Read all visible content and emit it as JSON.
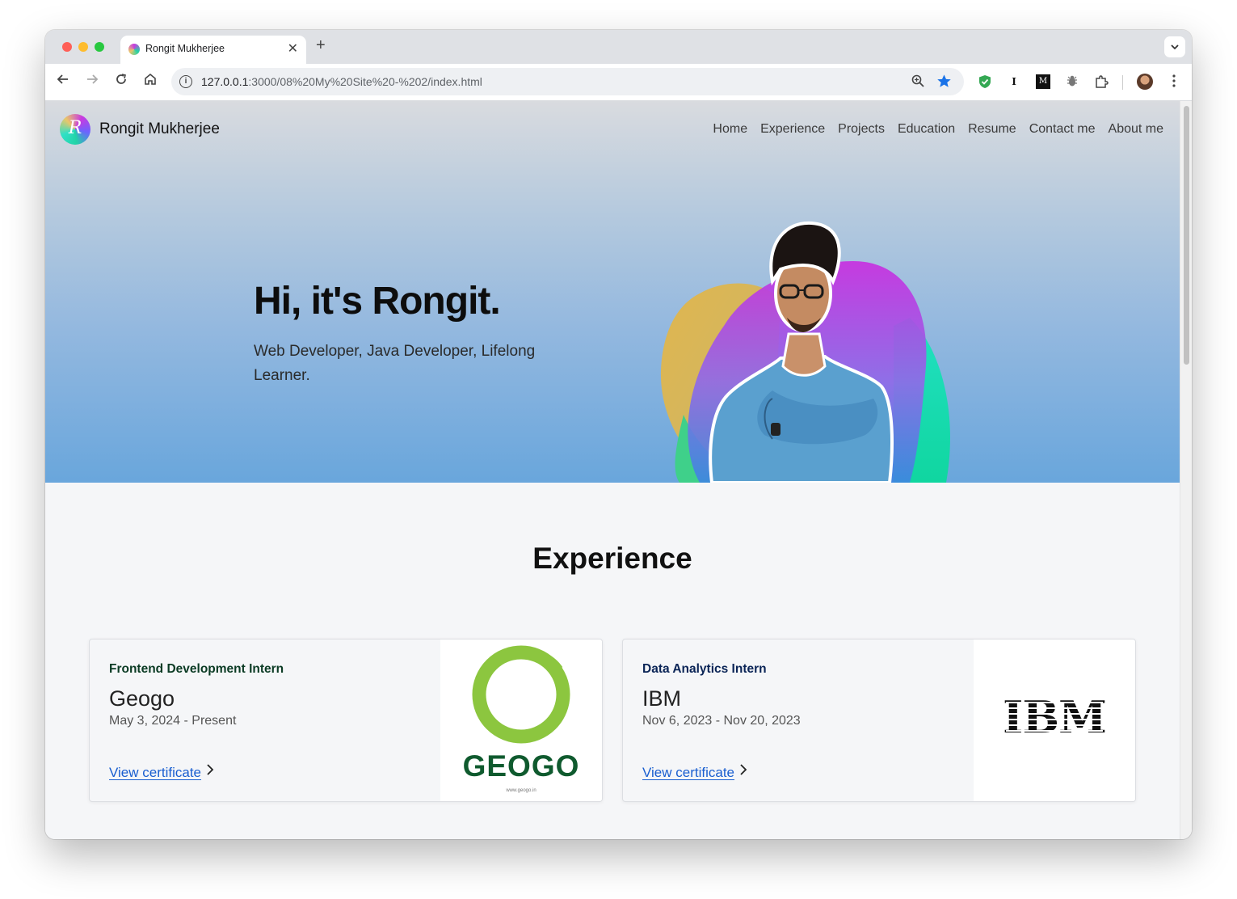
{
  "browser": {
    "tab_title": "Rongit Mukherjee",
    "tab_close": "✕",
    "new_tab": "+",
    "url_host": "127.0.0.1",
    "url_rest": ":3000/08%20My%20Site%20-%202/index.html",
    "icons": [
      "back-arrow-icon",
      "forward-arrow-icon",
      "reload-icon",
      "home-icon",
      "info-icon",
      "zoom-icon",
      "bookmark-star-icon",
      "shield-extension-icon",
      "instapaper-extension-icon",
      "medium-extension-icon",
      "bug-extension-icon",
      "puzzle-extensions-icon",
      "profile-avatar-icon",
      "kebab-menu-icon"
    ]
  },
  "site": {
    "brand_name": "Rongit Mukherjee",
    "brand_initial": "R",
    "nav": [
      "Home",
      "Experience",
      "Projects",
      "Education",
      "Resume",
      "Contact me",
      "About me"
    ]
  },
  "hero": {
    "title": "Hi, it's Rongit.",
    "subtitle": "Web Developer, Java Developer, Lifelong Learner."
  },
  "experience": {
    "heading": "Experience",
    "cards": [
      {
        "role": "Frontend Development Intern",
        "company": "Geogo",
        "dates": "May 3, 2024 - Present",
        "link": "View certificate",
        "logo_text": "GEOGO",
        "logo_caption": "www.geogo.in",
        "role_color": "#0b3b24"
      },
      {
        "role": "Data Analytics Intern",
        "company": "IBM",
        "dates": "Nov 6, 2023 - Nov 20, 2023",
        "link": "View certificate",
        "logo_text": "IBM",
        "role_color": "#0a2456"
      }
    ]
  },
  "colors": {
    "link": "#1a5fd0",
    "bookmark": "#1a73e8",
    "geogo_green": "#0f5a2e",
    "geogo_lime": "#8cc63f"
  }
}
